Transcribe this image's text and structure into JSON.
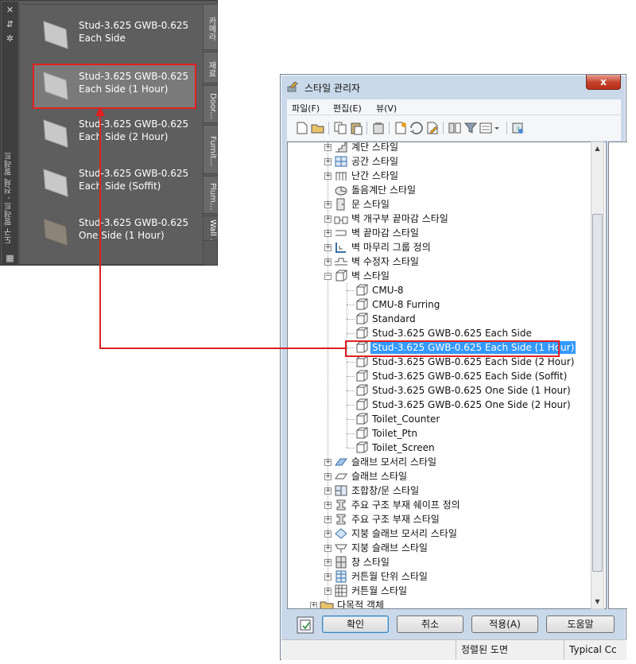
{
  "palette": {
    "vertical_title": "도구 팔레트 - 전체 팔레트",
    "items": [
      {
        "label_line1": "Stud-3.625 GWB-0.625",
        "label_line2": "Each Side",
        "thumb": "wall-light"
      },
      {
        "label_line1": "Stud-3.625 GWB-0.625",
        "label_line2": "Each Side (1 Hour)",
        "thumb": "wall-light"
      },
      {
        "label_line1": "Stud-3.625 GWB-0.625",
        "label_line2": "Each Side (2 Hour)",
        "thumb": "wall-light"
      },
      {
        "label_line1": "Stud-3.625 GWB-0.625",
        "label_line2": "Each Side (Soffit)",
        "thumb": "wall-light"
      },
      {
        "label_line1": "Stud-3.625 GWB-0.625",
        "label_line2": "One Side (1 Hour)",
        "thumb": "wall-dark"
      }
    ],
    "tabs": [
      "카메라",
      "재료",
      "Door...",
      "Furnit...",
      "Plum...",
      "Wall ..."
    ],
    "active_tab_index": 5,
    "icons": [
      "close-icon",
      "autohide-icon",
      "properties-icon",
      "palette-menu-icon"
    ]
  },
  "style_manager": {
    "title": "스타일 관리자",
    "close_label": "x",
    "menu": [
      "파일(F)",
      "편집(E)",
      "뷰(V)"
    ],
    "tree": [
      {
        "label": "계단 스타일",
        "level": 1,
        "expander": "+",
        "icon": "stair-icon"
      },
      {
        "label": "공간 스타일",
        "level": 1,
        "expander": "+",
        "icon": "space-icon"
      },
      {
        "label": "난간 스타일",
        "level": 1,
        "expander": "+",
        "icon": "railing-icon"
      },
      {
        "label": "돌음계단 스타일",
        "level": 1,
        "expander": "",
        "icon": "spiral-stair-icon"
      },
      {
        "label": "문 스타일",
        "level": 1,
        "expander": "+",
        "icon": "door-icon"
      },
      {
        "label": "벽 개구부 끝마감 스타일",
        "level": 1,
        "expander": "+",
        "icon": "wall-opening-icon"
      },
      {
        "label": "벽 끝마감 스타일",
        "level": 1,
        "expander": "+",
        "icon": "wall-endcap-icon"
      },
      {
        "label": "벽 마무리 그룹 정의",
        "level": 1,
        "expander": "+",
        "icon": "cleanup-group-icon"
      },
      {
        "label": "벽 수정자 스타일",
        "level": 1,
        "expander": "+",
        "icon": "wall-modifier-icon"
      },
      {
        "label": "벽 스타일",
        "level": 1,
        "expander": "-",
        "icon": "wall-style-folder-icon"
      },
      {
        "label": "CMU-8",
        "level": 2,
        "expander": "",
        "icon": "wall-style-icon"
      },
      {
        "label": "CMU-8 Furring",
        "level": 2,
        "expander": "",
        "icon": "wall-style-icon"
      },
      {
        "label": "Standard",
        "level": 2,
        "expander": "",
        "icon": "wall-style-icon"
      },
      {
        "label": "Stud-3.625 GWB-0.625 Each Side",
        "level": 2,
        "expander": "",
        "icon": "wall-style-icon"
      },
      {
        "label": "Stud-3.625 GWB-0.625 Each Side (1 Hour)",
        "level": 2,
        "expander": "",
        "icon": "wall-style-icon",
        "selected": true
      },
      {
        "label": "Stud-3.625 GWB-0.625 Each Side (2 Hour)",
        "level": 2,
        "expander": "",
        "icon": "wall-style-icon"
      },
      {
        "label": "Stud-3.625 GWB-0.625 Each Side (Soffit)",
        "level": 2,
        "expander": "",
        "icon": "wall-style-icon"
      },
      {
        "label": "Stud-3.625 GWB-0.625 One Side (1 Hour)",
        "level": 2,
        "expander": "",
        "icon": "wall-style-icon"
      },
      {
        "label": "Stud-3.625 GWB-0.625 One Side (2 Hour)",
        "level": 2,
        "expander": "",
        "icon": "wall-style-icon"
      },
      {
        "label": "Toilet_Counter",
        "level": 2,
        "expander": "",
        "icon": "wall-style-icon"
      },
      {
        "label": "Toilet_Ptn",
        "level": 2,
        "expander": "",
        "icon": "wall-style-icon"
      },
      {
        "label": "Toilet_Screen",
        "level": 2,
        "expander": "",
        "icon": "wall-style-icon"
      },
      {
        "label": "슬래브 모서리 스타일",
        "level": 1,
        "expander": "+",
        "icon": "slab-edge-icon"
      },
      {
        "label": "슬래브 스타일",
        "level": 1,
        "expander": "+",
        "icon": "slab-icon"
      },
      {
        "label": "조합창/문 스타일",
        "level": 1,
        "expander": "+",
        "icon": "door-window-assembly-icon"
      },
      {
        "label": "주요 구조 부재 쉐이프 정의",
        "level": 1,
        "expander": "+",
        "icon": "member-shape-icon"
      },
      {
        "label": "주요 구조 부재 스타일",
        "level": 1,
        "expander": "+",
        "icon": "member-style-icon"
      },
      {
        "label": "지붕 슬래브 모서리 스타일",
        "level": 1,
        "expander": "+",
        "icon": "roof-slab-edge-icon"
      },
      {
        "label": "지붕 슬래브 스타일",
        "level": 1,
        "expander": "+",
        "icon": "roof-slab-icon"
      },
      {
        "label": "창 스타일",
        "level": 1,
        "expander": "+",
        "icon": "window-icon"
      },
      {
        "label": "커튼월 단위 스타일",
        "level": 1,
        "expander": "+",
        "icon": "curtain-wall-unit-icon"
      },
      {
        "label": "커튼월 스타일",
        "level": 1,
        "expander": "+",
        "icon": "curtain-wall-icon"
      },
      {
        "label": "다목적 객체",
        "level": 0,
        "expander": "+",
        "icon": "folder-icon"
      }
    ],
    "buttons": {
      "ok": "확인",
      "cancel": "취소",
      "apply": "적용(A)",
      "help": "도움말"
    },
    "status": {
      "left": "",
      "middle": "정렬된 도면",
      "right": "Typical Cc"
    }
  },
  "colors": {
    "highlight": "#3399ff",
    "annotation_red": "#e02020",
    "palette_bg": "#5b5b5b",
    "window_frame": "#c9d9ea"
  }
}
